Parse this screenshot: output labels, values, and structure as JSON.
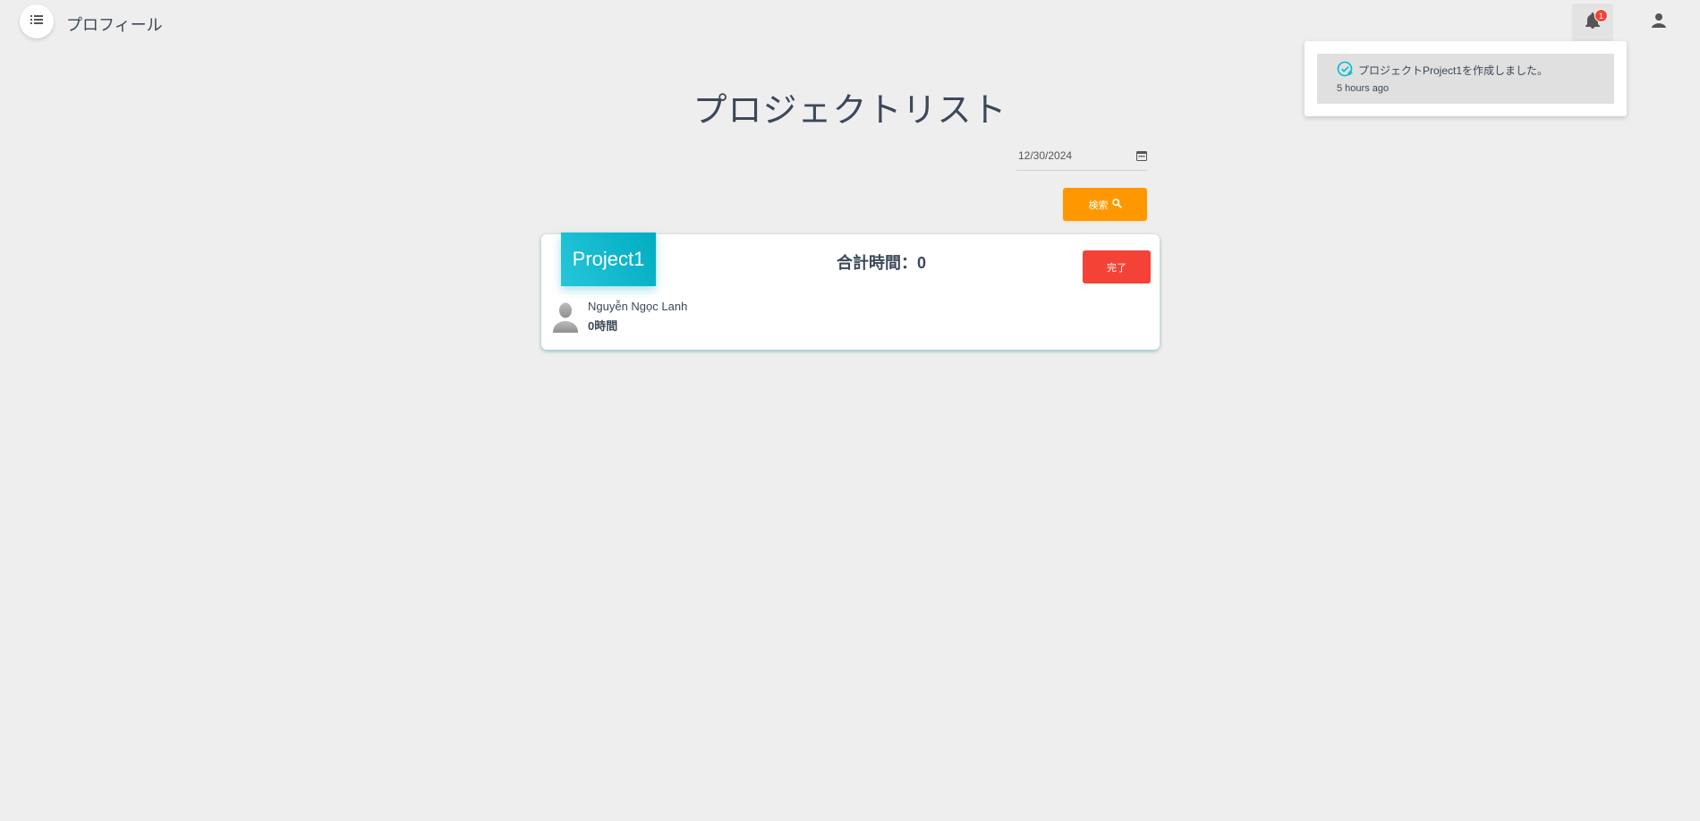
{
  "header": {
    "page_name": "プロフィール",
    "notification_count": "1"
  },
  "notifications": [
    {
      "message": "プロジェクトProject1を作成しました。",
      "time": "5 hours ago"
    }
  ],
  "main": {
    "title": "プロジェクトリスト",
    "date_value": "12/30/2024",
    "search_label": "検索"
  },
  "projects": [
    {
      "name": "Project1",
      "total_time": "合計時間：0",
      "done_label": "完了",
      "members": [
        {
          "name": "Nguyễn Ngọc Lanh",
          "hours": "0時間"
        }
      ]
    }
  ],
  "colors": {
    "background": "#eeeeee",
    "search_button": "#ff9800",
    "done_button": "#f44336",
    "project_tab": "#00acc1",
    "badge": "#f44336",
    "notification_check": "#00bcd4"
  },
  "icons": {
    "menu": "list-icon",
    "notifications": "bell-icon",
    "user": "person-icon",
    "calendar": "calendar-icon",
    "search": "search-icon",
    "notification_status": "check-circle-icon"
  }
}
